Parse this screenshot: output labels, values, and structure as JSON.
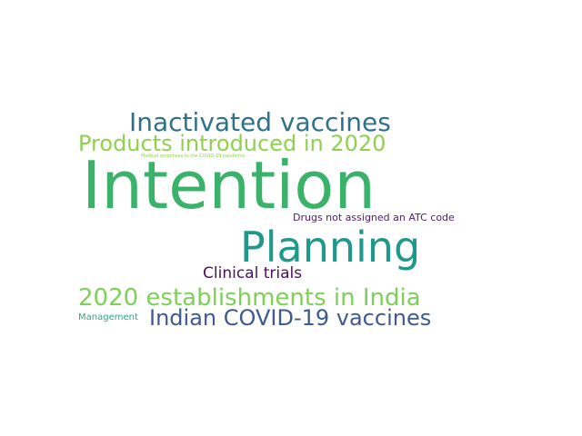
{
  "word_cloud": {
    "words": [
      {
        "id": "intention",
        "text": "Intention",
        "color": "#3bb26a"
      },
      {
        "id": "planning",
        "text": "Planning",
        "color": "#1f9a8a"
      },
      {
        "id": "inactivated",
        "text": "Inactivated vaccines",
        "color": "#2e7189"
      },
      {
        "id": "products",
        "text": "Products introduced in 2020",
        "color": "#8fd14f"
      },
      {
        "id": "establishments",
        "text": "2020 establishments in India",
        "color": "#7ed05a"
      },
      {
        "id": "indian",
        "text": "Indian COVID-19 vaccines",
        "color": "#3e5a93"
      },
      {
        "id": "clinical",
        "text": "Clinical trials",
        "color": "#4b0f5e"
      },
      {
        "id": "drugs",
        "text": "Drugs not assigned an ATC code",
        "color": "#4d1a6b"
      },
      {
        "id": "management",
        "text": "Management",
        "color": "#2aa886"
      },
      {
        "id": "medical",
        "text": "Medical responses to the COVID-19 pandemic",
        "color": "#8fd14f"
      }
    ]
  }
}
